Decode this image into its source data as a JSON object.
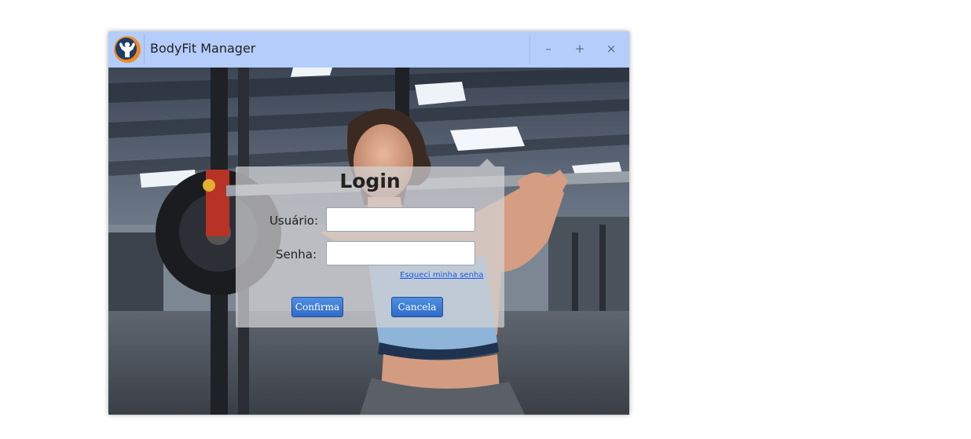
{
  "window": {
    "title": "BodyFit Manager",
    "controls": {
      "minimize": "–",
      "maximize": "+",
      "close": "×"
    }
  },
  "login": {
    "title": "Login",
    "username_label": "Usuário:",
    "username_value": "",
    "password_label": "Senha:",
    "password_value": "",
    "forgot_link": "Esqueci minha senha",
    "confirm_button": "Confirma",
    "cancel_button": "Cancela"
  },
  "colors": {
    "titlebar": "#b4cdfa",
    "button": "#3a7bd5",
    "link": "#1a58e0",
    "logo_ring": "#f28a1f",
    "logo_core": "#1d3c66"
  },
  "icons": {
    "app_logo": "bodybuilder-logo-icon",
    "background": "gym-woman-squat-background"
  }
}
